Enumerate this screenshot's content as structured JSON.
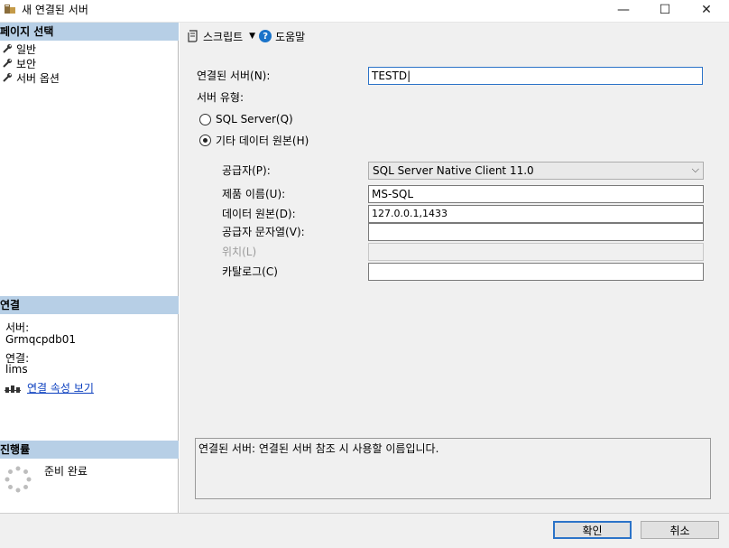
{
  "window": {
    "title": "새 연결된 서버",
    "minimize": "—",
    "maximize": "☐",
    "close": "✕"
  },
  "left": {
    "page_select_header": "페이지 선택",
    "nav": [
      {
        "label": "일반"
      },
      {
        "label": "보안"
      },
      {
        "label": "서버 옵션"
      }
    ],
    "connection_header": "연결",
    "server_label": "서버:",
    "server_value": "Grmqcpdb01",
    "connection_label": "연결:",
    "connection_value": "lims",
    "view_props_link": "연결 속성 보기",
    "progress_header": "진행률",
    "progress_status": "준비 완료"
  },
  "toolbar": {
    "script_label": "스크립트",
    "help_label": "도움말"
  },
  "form": {
    "linked_server_label": "연결된 서버(N):",
    "linked_server_value": "TESTD|",
    "server_type_label": "서버 유형:",
    "radio_sql_server": "SQL Server(Q)",
    "radio_other": "기타 데이터 원본(H)",
    "provider_label": "공급자(P):",
    "provider_value": "SQL Server Native Client 11.0",
    "product_label": "제품 이름(U):",
    "product_value": "MS-SQL",
    "datasource_label": "데이터 원본(D):",
    "datasource_value": "127.0.0.1,1433",
    "provstring_label": "공급자 문자열(V):",
    "provstring_value": "",
    "location_label": "위치(L)",
    "location_value": "",
    "catalog_label": "카탈로그(C)",
    "catalog_value": ""
  },
  "description": "연결된 서버: 연결된 서버 참조 시 사용할 이름입니다.",
  "buttons": {
    "ok": "확인",
    "cancel": "취소"
  }
}
